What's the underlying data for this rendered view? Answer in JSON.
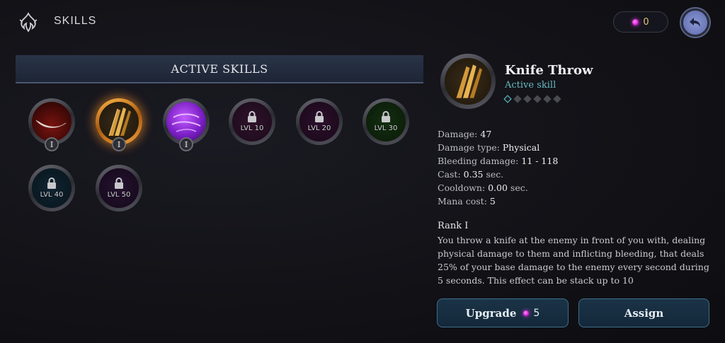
{
  "header": {
    "title": "SKILLS",
    "logo_icon": "flame-crest-icon",
    "back_icon": "back-arrow-icon"
  },
  "currency": {
    "value": "0",
    "icon": "pink-gem-icon"
  },
  "section": {
    "title": "ACTIVE SKILLS"
  },
  "skills": [
    {
      "name": "blood-slash",
      "rank": "I",
      "locked": false,
      "selected": false,
      "level_label": ""
    },
    {
      "name": "knife-throw",
      "rank": "I",
      "locked": false,
      "selected": true,
      "level_label": ""
    },
    {
      "name": "arcane-orb",
      "rank": "I",
      "locked": false,
      "selected": false,
      "level_label": ""
    },
    {
      "name": "locked-skill-10",
      "rank": "",
      "locked": true,
      "selected": false,
      "level_label": "LVL 10"
    },
    {
      "name": "locked-skill-20",
      "rank": "",
      "locked": true,
      "selected": false,
      "level_label": "LVL 20"
    },
    {
      "name": "locked-skill-30",
      "rank": "",
      "locked": true,
      "selected": false,
      "level_label": "LVL 30"
    },
    {
      "name": "locked-skill-40",
      "rank": "",
      "locked": true,
      "selected": false,
      "level_label": "LVL 40"
    },
    {
      "name": "locked-skill-50",
      "rank": "",
      "locked": true,
      "selected": false,
      "level_label": "LVL 50"
    }
  ],
  "detail": {
    "name": "Knife Throw",
    "type": "Active skill",
    "rank_current": 1,
    "rank_max": 6,
    "stats": {
      "damage_label": "Damage:",
      "damage_value": "47",
      "damage_type_label": "Damage type:",
      "damage_type_value": "Physical",
      "bleeding_label": "Bleeding damage:",
      "bleeding_value": "11 - 118",
      "cast_label": "Cast:",
      "cast_value": "0.35",
      "cast_unit": "sec.",
      "cooldown_label": "Cooldown:",
      "cooldown_value": "0.00",
      "cooldown_unit": "sec.",
      "mana_label": "Mana cost:",
      "mana_value": "5"
    },
    "rank_title": "Rank I",
    "description": "You throw a knife at the enemy in front of you with, dealing physical damage to them and inflicting bleeding, that deals 25% of your base damage to the enemy every second during 5 seconds. This effect can be stack up to 10"
  },
  "buttons": {
    "upgrade_label": "Upgrade",
    "upgrade_cost": "5",
    "assign_label": "Assign"
  },
  "colors": {
    "accent_teal": "#5fd0d8",
    "selected_glow": "#ffa030",
    "gem_pink": "#e03be0"
  }
}
